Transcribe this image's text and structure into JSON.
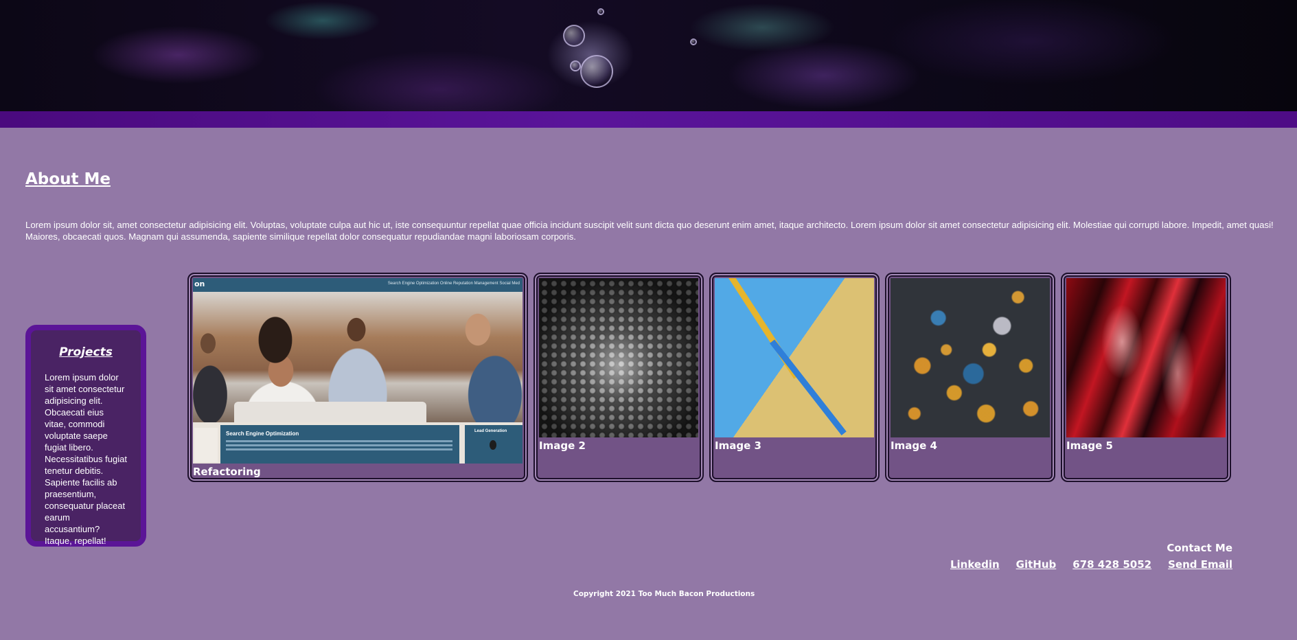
{
  "about": {
    "title": "About Me",
    "text": "Lorem ipsum dolor sit, amet consectetur adipisicing elit. Voluptas, voluptate culpa aut hic ut, iste consequuntur repellat quae officia incidunt suscipit velit sunt dicta quo deserunt enim amet, itaque architecto. Lorem ipsum dolor sit amet consectetur adipisicing elit. Molestiae qui corrupti labore. Impedit, amet quasi! Maiores, obcaecati quos. Magnam qui assumenda, sapiente similique repellat dolor consequatur repudiandae magni laboriosam corporis."
  },
  "projects": {
    "title": "Projects",
    "text": "Lorem ipsum dolor sit amet consectetur adipisicing elit. Obcaecati eius vitae, commodi voluptate saepe fugiat libero. Necessitatibus fugiat tenetur debitis. Sapiente facilis ab praesentium, consequatur placeat earum accusantium? Itaque, repellat!"
  },
  "gallery": {
    "cards": [
      {
        "caption": "Refactoring",
        "screenshot": {
          "brand": "on",
          "nav_links": "Search Engine Optimization     Online Reputation Management     Social Med",
          "panel_title": "Search Engine Optimization",
          "side_title": "Lead Generation"
        }
      },
      {
        "caption": "Image 2"
      },
      {
        "caption": "Image 3"
      },
      {
        "caption": "Image 4"
      },
      {
        "caption": "Image 5"
      }
    ]
  },
  "contact": {
    "title": "Contact Me",
    "links": [
      "Linkedin",
      "GitHub",
      "678 428 5052",
      "Send Email"
    ]
  },
  "footer": {
    "copyright": "Copyright 2021 Too Much Bacon Productions"
  },
  "colors": {
    "background": "#9278a6",
    "band": "#4a0a7e",
    "projects_bg": "#4a2364",
    "projects_border": "#5b1597",
    "card_bg": "#725386"
  }
}
